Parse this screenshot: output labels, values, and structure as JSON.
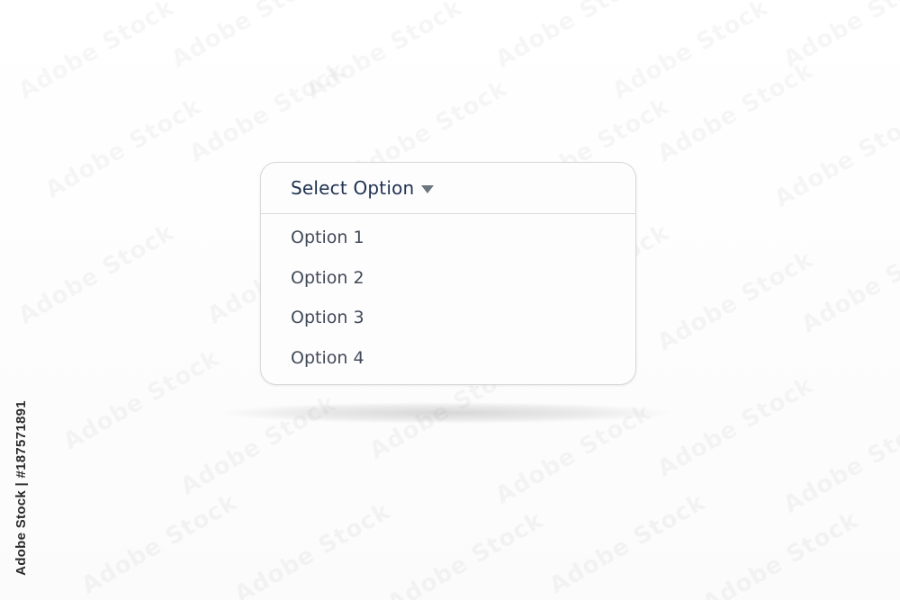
{
  "dropdown": {
    "title": "Select Option",
    "caret_icon": "triangle-down-icon",
    "options": [
      {
        "label": "Option 1"
      },
      {
        "label": "Option 2"
      },
      {
        "label": "Option 3"
      },
      {
        "label": "Option 4"
      }
    ]
  },
  "watermark": {
    "text": "Adobe Stock",
    "credit": "Adobe Stock | #187571891"
  },
  "colors": {
    "title_text": "#1f3150",
    "option_text": "#414a58",
    "border": "#d6d8dc",
    "caret": "#6d7580"
  }
}
